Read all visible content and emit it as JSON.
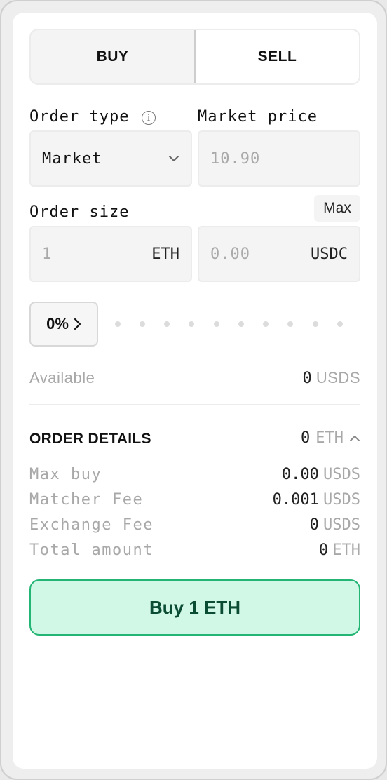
{
  "tabs": {
    "buy": "BUY",
    "sell": "SELL"
  },
  "order_type": {
    "label": "Order type",
    "info_icon": "i",
    "value": "Market"
  },
  "market_price": {
    "label": "Market price",
    "placeholder": "10.90"
  },
  "order_size": {
    "label": "Order size",
    "max_label": "Max",
    "base_placeholder": "1",
    "base_unit": "ETH",
    "quote_placeholder": "0.00",
    "quote_unit": "USDC"
  },
  "percent": {
    "value": "0%",
    "slider_level": 0
  },
  "available": {
    "label": "Available",
    "value": "0",
    "unit": "USDS"
  },
  "order_details": {
    "title": "ORDER DETAILS",
    "summary_value": "0",
    "summary_unit": "ETH",
    "rows": [
      {
        "label": "Max buy",
        "value": "0.00",
        "unit": "USDS"
      },
      {
        "label": "Matcher Fee",
        "value": "0.001",
        "unit": "USDS"
      },
      {
        "label": "Exchange Fee",
        "value": "0",
        "unit": "USDS"
      },
      {
        "label": "Total amount",
        "value": "0",
        "unit": "ETH"
      }
    ]
  },
  "submit": {
    "label": "Buy 1 ETH"
  },
  "colors": {
    "accent_fill": "#d1f7e6",
    "accent_border": "#22b574",
    "accent_text": "#0a4d34"
  }
}
